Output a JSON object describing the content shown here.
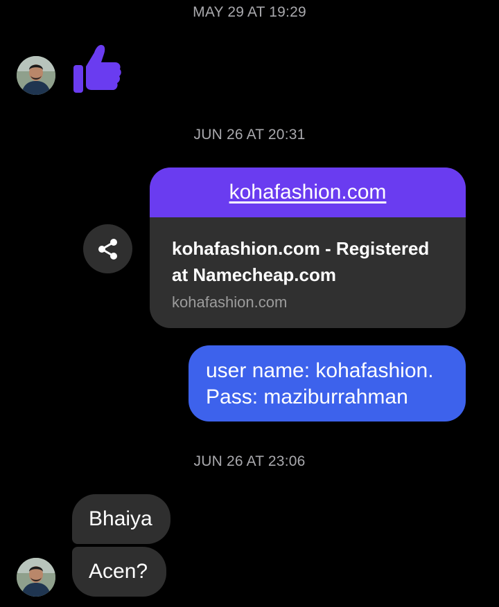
{
  "timestamps": {
    "first": "MAY 29 AT 19:29",
    "second": "JUN 26 AT 20:31",
    "third": "JUN 26 AT 23:06"
  },
  "thumbs_up": {
    "icon": "thumbs-up-icon",
    "color": "#6a3cf0"
  },
  "link_preview": {
    "banner_text": "kohafashion.com",
    "title": "kohafashion.com - Registered at Namecheap.com",
    "domain": "kohafashion.com",
    "banner_color": "#6a3cf0"
  },
  "share_button": {
    "icon": "share-icon"
  },
  "outgoing_message": {
    "line1": "user name: kohafashion.",
    "line2": "Pass: maziburrahman",
    "color": "#3d62ec"
  },
  "incoming_messages": [
    {
      "text": "Bhaiya"
    },
    {
      "text": "Acen?"
    }
  ]
}
